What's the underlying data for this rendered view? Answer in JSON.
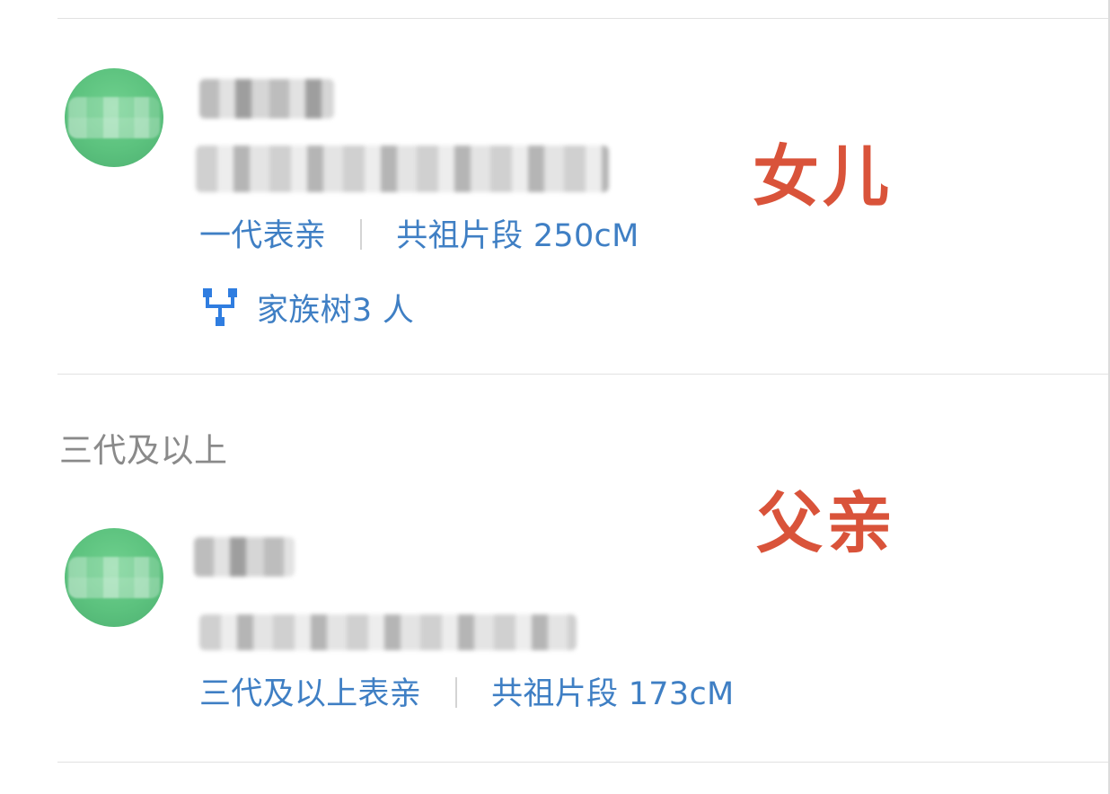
{
  "entries": [
    {
      "relationship": "一代表亲",
      "segments": "共祖片段 250cM",
      "family_tree": "家族树3 人",
      "annotation": "女儿"
    },
    {
      "relationship": "三代及以上表亲",
      "segments": "共祖片段 173cM",
      "annotation": "父亲"
    }
  ],
  "sections": {
    "third_gen_label": "三代及以上"
  },
  "colors": {
    "link_blue": "#3f7fc4",
    "annotation_red": "#d9533a",
    "avatar_green": "#5cc27e"
  }
}
